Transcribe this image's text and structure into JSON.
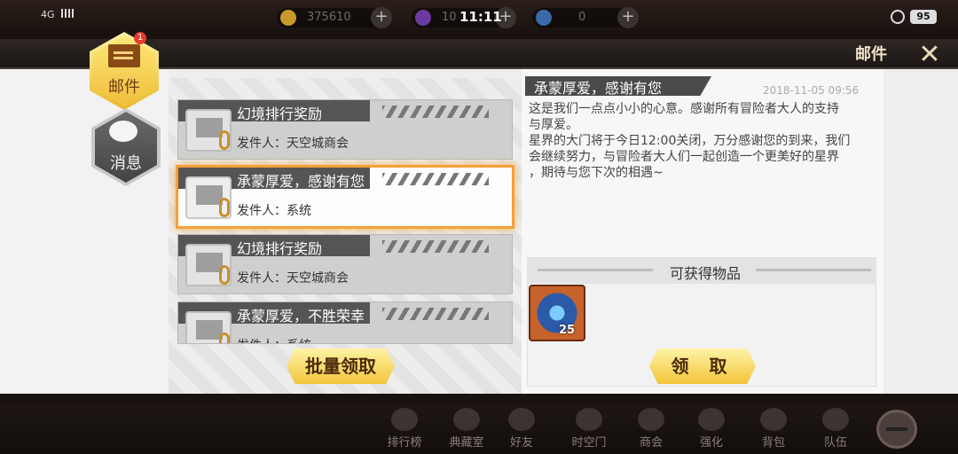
{
  "status": {
    "network": "4G",
    "time": "11:11",
    "battery": "95"
  },
  "currency": {
    "gold": "375610",
    "crystal": "10",
    "blue": "0"
  },
  "header": {
    "title": "邮件",
    "close_icon": "close-x-icon"
  },
  "tabs": [
    {
      "label": "邮件",
      "badge": "1",
      "icon": "mail-icon",
      "selected": true
    },
    {
      "label": "消息",
      "icon": "chat-icon",
      "selected": false
    }
  ],
  "mails": [
    {
      "title": "幻境排行奖励",
      "sender": "发件人：天空城商会",
      "selected": false
    },
    {
      "title": "承蒙厚爱，感谢有您",
      "sender": "发件人：系统",
      "selected": true
    },
    {
      "title": "幻境排行奖励",
      "sender": "发件人：天空城商会",
      "selected": false
    },
    {
      "title": "承蒙厚爱，不胜荣幸",
      "sender": "发件人：系统",
      "selected": false
    }
  ],
  "bulk_claim_label": "批量领取",
  "detail": {
    "title": "承蒙厚爱，感谢有您",
    "date": "2018-11-05  09:56",
    "body_lines": [
      "这是我们一点点小小的心意。感谢所有冒险者大人的支持",
      "与厚爱。",
      "星界的大门将于今日12:00关闭，万分感谢您的到来，我们",
      "会继续努力，与冒险者大人们一起创造一个更美好的星界",
      "，期待与您下次的相遇~"
    ],
    "items_title": "可获得物品",
    "reward": {
      "count": "25",
      "icon": "card-pack-icon"
    },
    "claim_label": "领 取"
  },
  "bottom_nav": [
    {
      "label": "排行榜",
      "icon": "trophy-icon"
    },
    {
      "label": "典藏室",
      "icon": "collection-icon"
    },
    {
      "label": "好友",
      "icon": "friends-icon"
    },
    {
      "label": "时空门",
      "icon": "portal-icon"
    },
    {
      "label": "商会",
      "icon": "shop-icon"
    },
    {
      "label": "强化",
      "icon": "hammer-icon"
    },
    {
      "label": "背包",
      "icon": "bag-icon"
    },
    {
      "label": "队伍",
      "icon": "team-icon"
    }
  ],
  "colors": {
    "accent_gold": "#f1c53a",
    "selected_border": "#f5a03b",
    "badge_red": "#e33b2c"
  }
}
